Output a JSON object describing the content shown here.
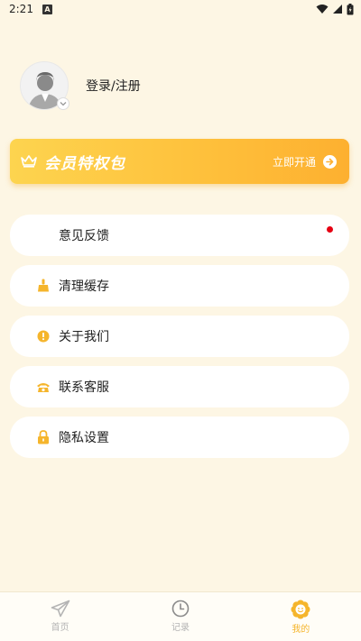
{
  "status_bar": {
    "time": "2:21",
    "notification_letter": "A"
  },
  "profile": {
    "login_text": "登录/注册"
  },
  "vip": {
    "title": "会员特权包",
    "open_label": "立即开通"
  },
  "menu": {
    "items": [
      {
        "label": "意见反馈",
        "icon": "none",
        "has_dot": true
      },
      {
        "label": "清理缓存",
        "icon": "broom-icon"
      },
      {
        "label": "关于我们",
        "icon": "info-icon"
      },
      {
        "label": "联系客服",
        "icon": "phone-icon"
      },
      {
        "label": "隐私设置",
        "icon": "lock-icon"
      }
    ]
  },
  "tabbar": {
    "tabs": [
      {
        "label": "首页",
        "icon": "paper-plane-icon",
        "active": false
      },
      {
        "label": "记录",
        "icon": "clock-icon",
        "active": false
      },
      {
        "label": "我的",
        "icon": "flower-smile-icon",
        "active": true
      }
    ]
  },
  "colors": {
    "background": "#fdf6e4",
    "accent": "#f5b52c",
    "vip_gradient_start": "#fdd44f",
    "vip_gradient_end": "#fdb030",
    "notification_dot": "#e60012"
  }
}
